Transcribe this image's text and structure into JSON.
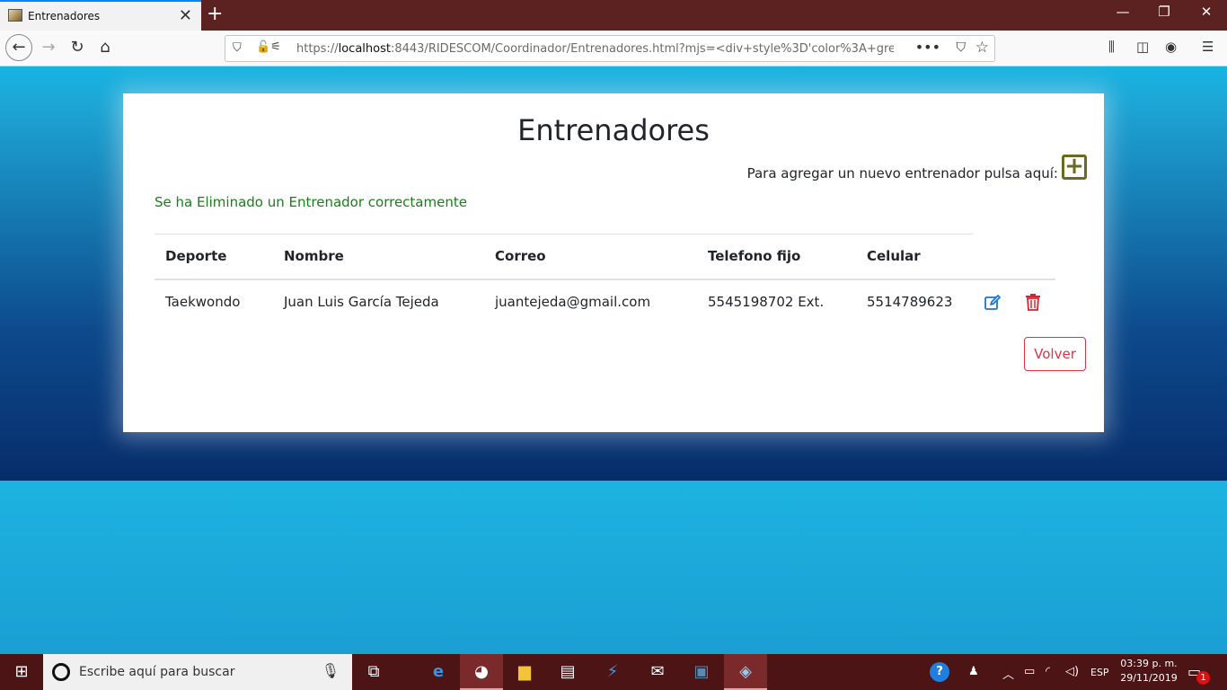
{
  "browser": {
    "tab_title": "Entrenadores",
    "url_prefix": "https://",
    "url_host": "localhost",
    "url_rest": ":8443/RIDESCOM/Coordinador/Entrenadores.html?mjs=<div+style%3D'color%3A+green%3"
  },
  "page": {
    "title": "Entrenadores",
    "add_text": "Para agregar un nuevo entrenador pulsa aquí:",
    "message": "Se ha Eliminado un Entrenador correctamente",
    "back_label": "Volver"
  },
  "table": {
    "headers": [
      "Deporte",
      "Nombre",
      "Correo",
      "Telefono fijo",
      "Celular"
    ],
    "rows": [
      {
        "deporte": "Taekwondo",
        "nombre": "Juan Luis García Tejeda",
        "correo": "juantejeda@gmail.com",
        "telefono": "5545198702 Ext.",
        "celular": "5514789623"
      }
    ]
  },
  "taskbar": {
    "search_placeholder": "Escribe aquí para buscar",
    "language": "ESP",
    "time": "03:39 p. m.",
    "date": "29/11/2019",
    "notification_count": "1"
  },
  "colors": {
    "success": "#1a7e1a",
    "danger": "#dc3545",
    "edit": "#1e73d8",
    "add": "#6b6b1f"
  }
}
